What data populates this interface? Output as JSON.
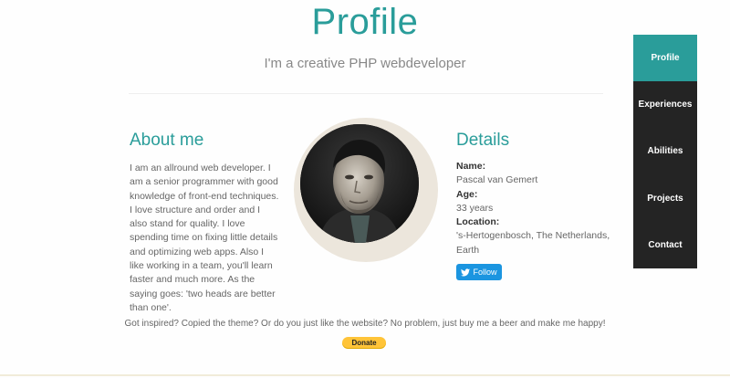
{
  "header": {
    "title": "Profile",
    "subtitle": "I'm a creative PHP webdeveloper"
  },
  "about": {
    "title": "About me",
    "text": "I am an allround web developer. I am a senior programmer with good knowledge of front-end techniques. I love structure and order and I also stand for quality. I love spending time on fixing little details and optimizing web apps. Also I like working in a team, you'll learn faster and much more. As the saying goes: 'two heads are better than one'."
  },
  "details": {
    "title": "Details",
    "name_label": "Name:",
    "name_value": "Pascal van Gemert",
    "age_label": "Age:",
    "age_value": "33 years",
    "location_label": "Location:",
    "location_value": "'s-Hertogenbosch, The Netherlands, Earth",
    "follow_label": "Follow"
  },
  "footer": {
    "text": "Got inspired? Copied the theme? Or do you just like the website? No problem, just buy me a beer and make me happy!",
    "donate_label": "Donate"
  },
  "nav": {
    "items": [
      {
        "label": "Profile"
      },
      {
        "label": "Experiences"
      },
      {
        "label": "Abilities"
      },
      {
        "label": "Projects"
      },
      {
        "label": "Contact"
      }
    ],
    "active": "Profile"
  },
  "colors": {
    "accent": "#2a9d9a",
    "nav_bg": "#242424",
    "twitter": "#1b95e0",
    "donate": "#ffc439"
  }
}
